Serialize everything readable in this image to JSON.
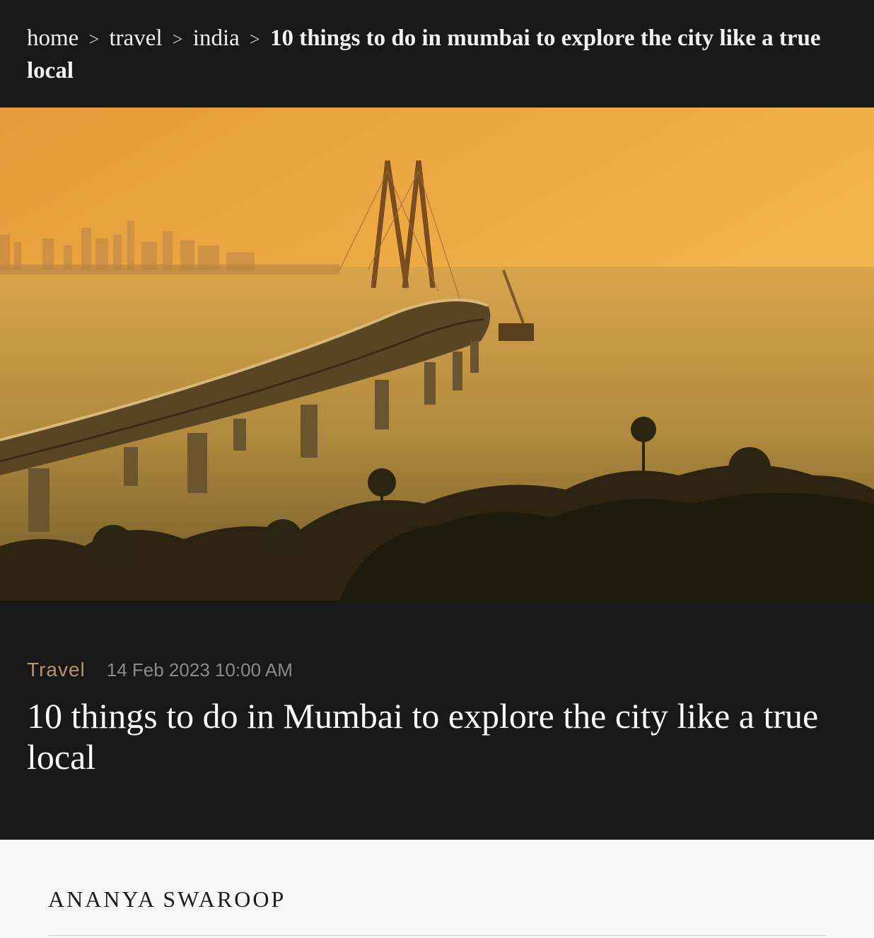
{
  "breadcrumb": {
    "items": [
      "home",
      "travel",
      "india"
    ],
    "separator": ">",
    "current": "10 things to do in mumbai to explore the city like a true local"
  },
  "hero": {
    "image_subject": "sea-link-bridge-at-sunset"
  },
  "article": {
    "category": "Travel",
    "timestamp": "14 Feb 2023 10:00 AM",
    "title": "10 things to do in Mumbai to explore the city like a true local"
  },
  "author": {
    "name": "ANANYA SWAROOP"
  },
  "colors": {
    "background": "#181818",
    "accent": "#b89566",
    "author_bg": "#f7f7f7"
  }
}
